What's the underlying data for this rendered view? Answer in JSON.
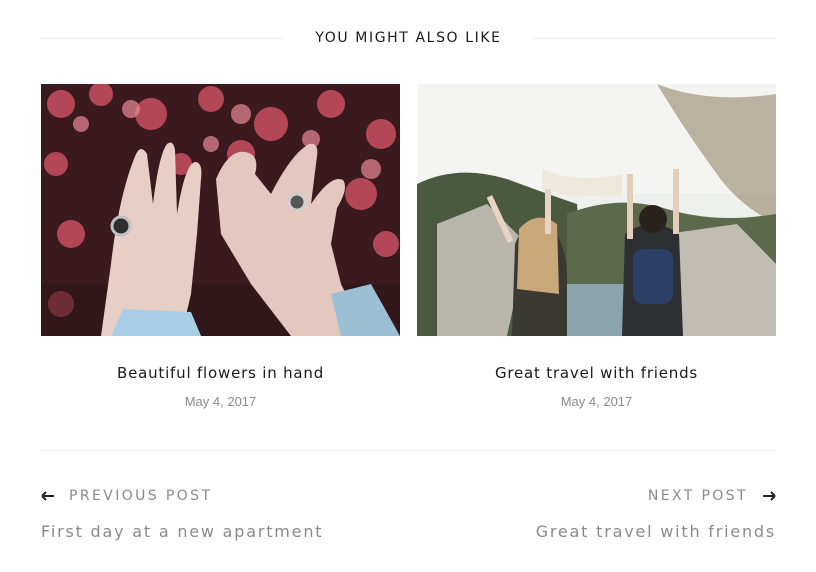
{
  "related": {
    "heading": "YOU MIGHT ALSO LIKE",
    "posts": [
      {
        "title": "Beautiful flowers in hand",
        "date": "May 4, 2017",
        "image": "flowers-hands-photo"
      },
      {
        "title": "Great travel with friends",
        "date": "May 4, 2017",
        "image": "friends-cliff-photo"
      }
    ]
  },
  "post_nav": {
    "previous": {
      "label": "PREVIOUS POST",
      "title": "First day at a new apartment",
      "icon": "arrow-left-icon"
    },
    "next": {
      "label": "NEXT POST",
      "title": "Great travel with friends",
      "icon": "arrow-right-icon"
    }
  }
}
